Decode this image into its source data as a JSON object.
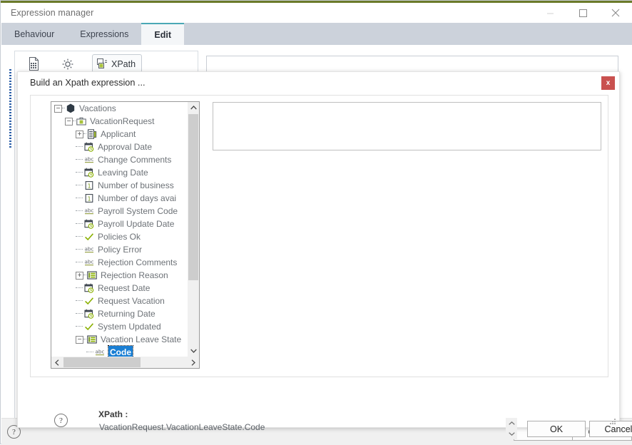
{
  "window": {
    "title": "Expression manager",
    "controls": {
      "minimize": "minimize-icon",
      "maximize": "maximize-icon",
      "close": "close-icon"
    },
    "accent_color": "#6b7a2a"
  },
  "tabs": [
    {
      "label": "Behaviour",
      "active": false
    },
    {
      "label": "Expressions",
      "active": false
    },
    {
      "label": "Edit",
      "active": true
    }
  ],
  "toolbar": {
    "document_icon": "document-icon",
    "settings_icon": "gear-icon",
    "xpath_button": "XPath",
    "xpath_icon": "xpath-icon"
  },
  "window_footer": {
    "help": "?",
    "ok_label": "OK",
    "cancel_label": "Cancel"
  },
  "dialog": {
    "title": "Build an Xpath expression ...",
    "close_label": "x",
    "close_color": "#c9514f",
    "help": "?",
    "ok_label": "OK",
    "cancel_label": "Cancel",
    "spinner_up": "▲",
    "spinner_down": "▼",
    "xpath_caption": "XPath :",
    "xpath_value": "VacationRequest.VacationLeaveState.Code",
    "selection_color": "#1a7fd4"
  },
  "tree": {
    "items": [
      {
        "label": "Vacations",
        "depth": 0,
        "icon": "hexagon-icon",
        "expander": "minus",
        "selected": false
      },
      {
        "label": "VacationRequest",
        "depth": 1,
        "icon": "briefcase-icon",
        "expander": "minus",
        "selected": false
      },
      {
        "label": "Applicant",
        "depth": 2,
        "icon": "form-icon",
        "expander": "plus",
        "selected": false
      },
      {
        "label": "Approval Date",
        "depth": 2,
        "icon": "date-icon",
        "expander": "none",
        "selected": false
      },
      {
        "label": "Change Comments",
        "depth": 2,
        "icon": "abc-icon",
        "expander": "none",
        "selected": false
      },
      {
        "label": "Leaving Date",
        "depth": 2,
        "icon": "date-icon",
        "expander": "none",
        "selected": false
      },
      {
        "label": "Number of business",
        "depth": 2,
        "icon": "number-icon",
        "expander": "none",
        "selected": false
      },
      {
        "label": "Number of days avai",
        "depth": 2,
        "icon": "number-icon",
        "expander": "none",
        "selected": false
      },
      {
        "label": "Payroll System Code",
        "depth": 2,
        "icon": "abc-icon",
        "expander": "none",
        "selected": false
      },
      {
        "label": "Payroll Update Date",
        "depth": 2,
        "icon": "date-icon",
        "expander": "none",
        "selected": false
      },
      {
        "label": "Policies Ok",
        "depth": 2,
        "icon": "check-icon",
        "expander": "none",
        "selected": false
      },
      {
        "label": "Policy Error",
        "depth": 2,
        "icon": "abc-icon",
        "expander": "none",
        "selected": false
      },
      {
        "label": "Rejection Comments",
        "depth": 2,
        "icon": "abc-icon",
        "expander": "none",
        "selected": false
      },
      {
        "label": "Rejection Reason",
        "depth": 2,
        "icon": "list-icon",
        "expander": "plus",
        "selected": false
      },
      {
        "label": "Request Date",
        "depth": 2,
        "icon": "date-icon",
        "expander": "none",
        "selected": false
      },
      {
        "label": "Request Vacation",
        "depth": 2,
        "icon": "check-icon",
        "expander": "none",
        "selected": false
      },
      {
        "label": "Returning Date",
        "depth": 2,
        "icon": "date-icon",
        "expander": "none",
        "selected": false
      },
      {
        "label": "System Updated",
        "depth": 2,
        "icon": "check-icon",
        "expander": "none",
        "selected": false
      },
      {
        "label": "Vacation Leave State",
        "depth": 2,
        "icon": "list-icon",
        "expander": "minus",
        "selected": false
      },
      {
        "label": "Code",
        "depth": 3,
        "icon": "abc-icon",
        "expander": "none",
        "selected": true
      }
    ],
    "scroll": {
      "up_arrow": "⌃",
      "down_arrow": "⌄",
      "left_arrow": "❮",
      "right_arrow": "❯"
    }
  }
}
